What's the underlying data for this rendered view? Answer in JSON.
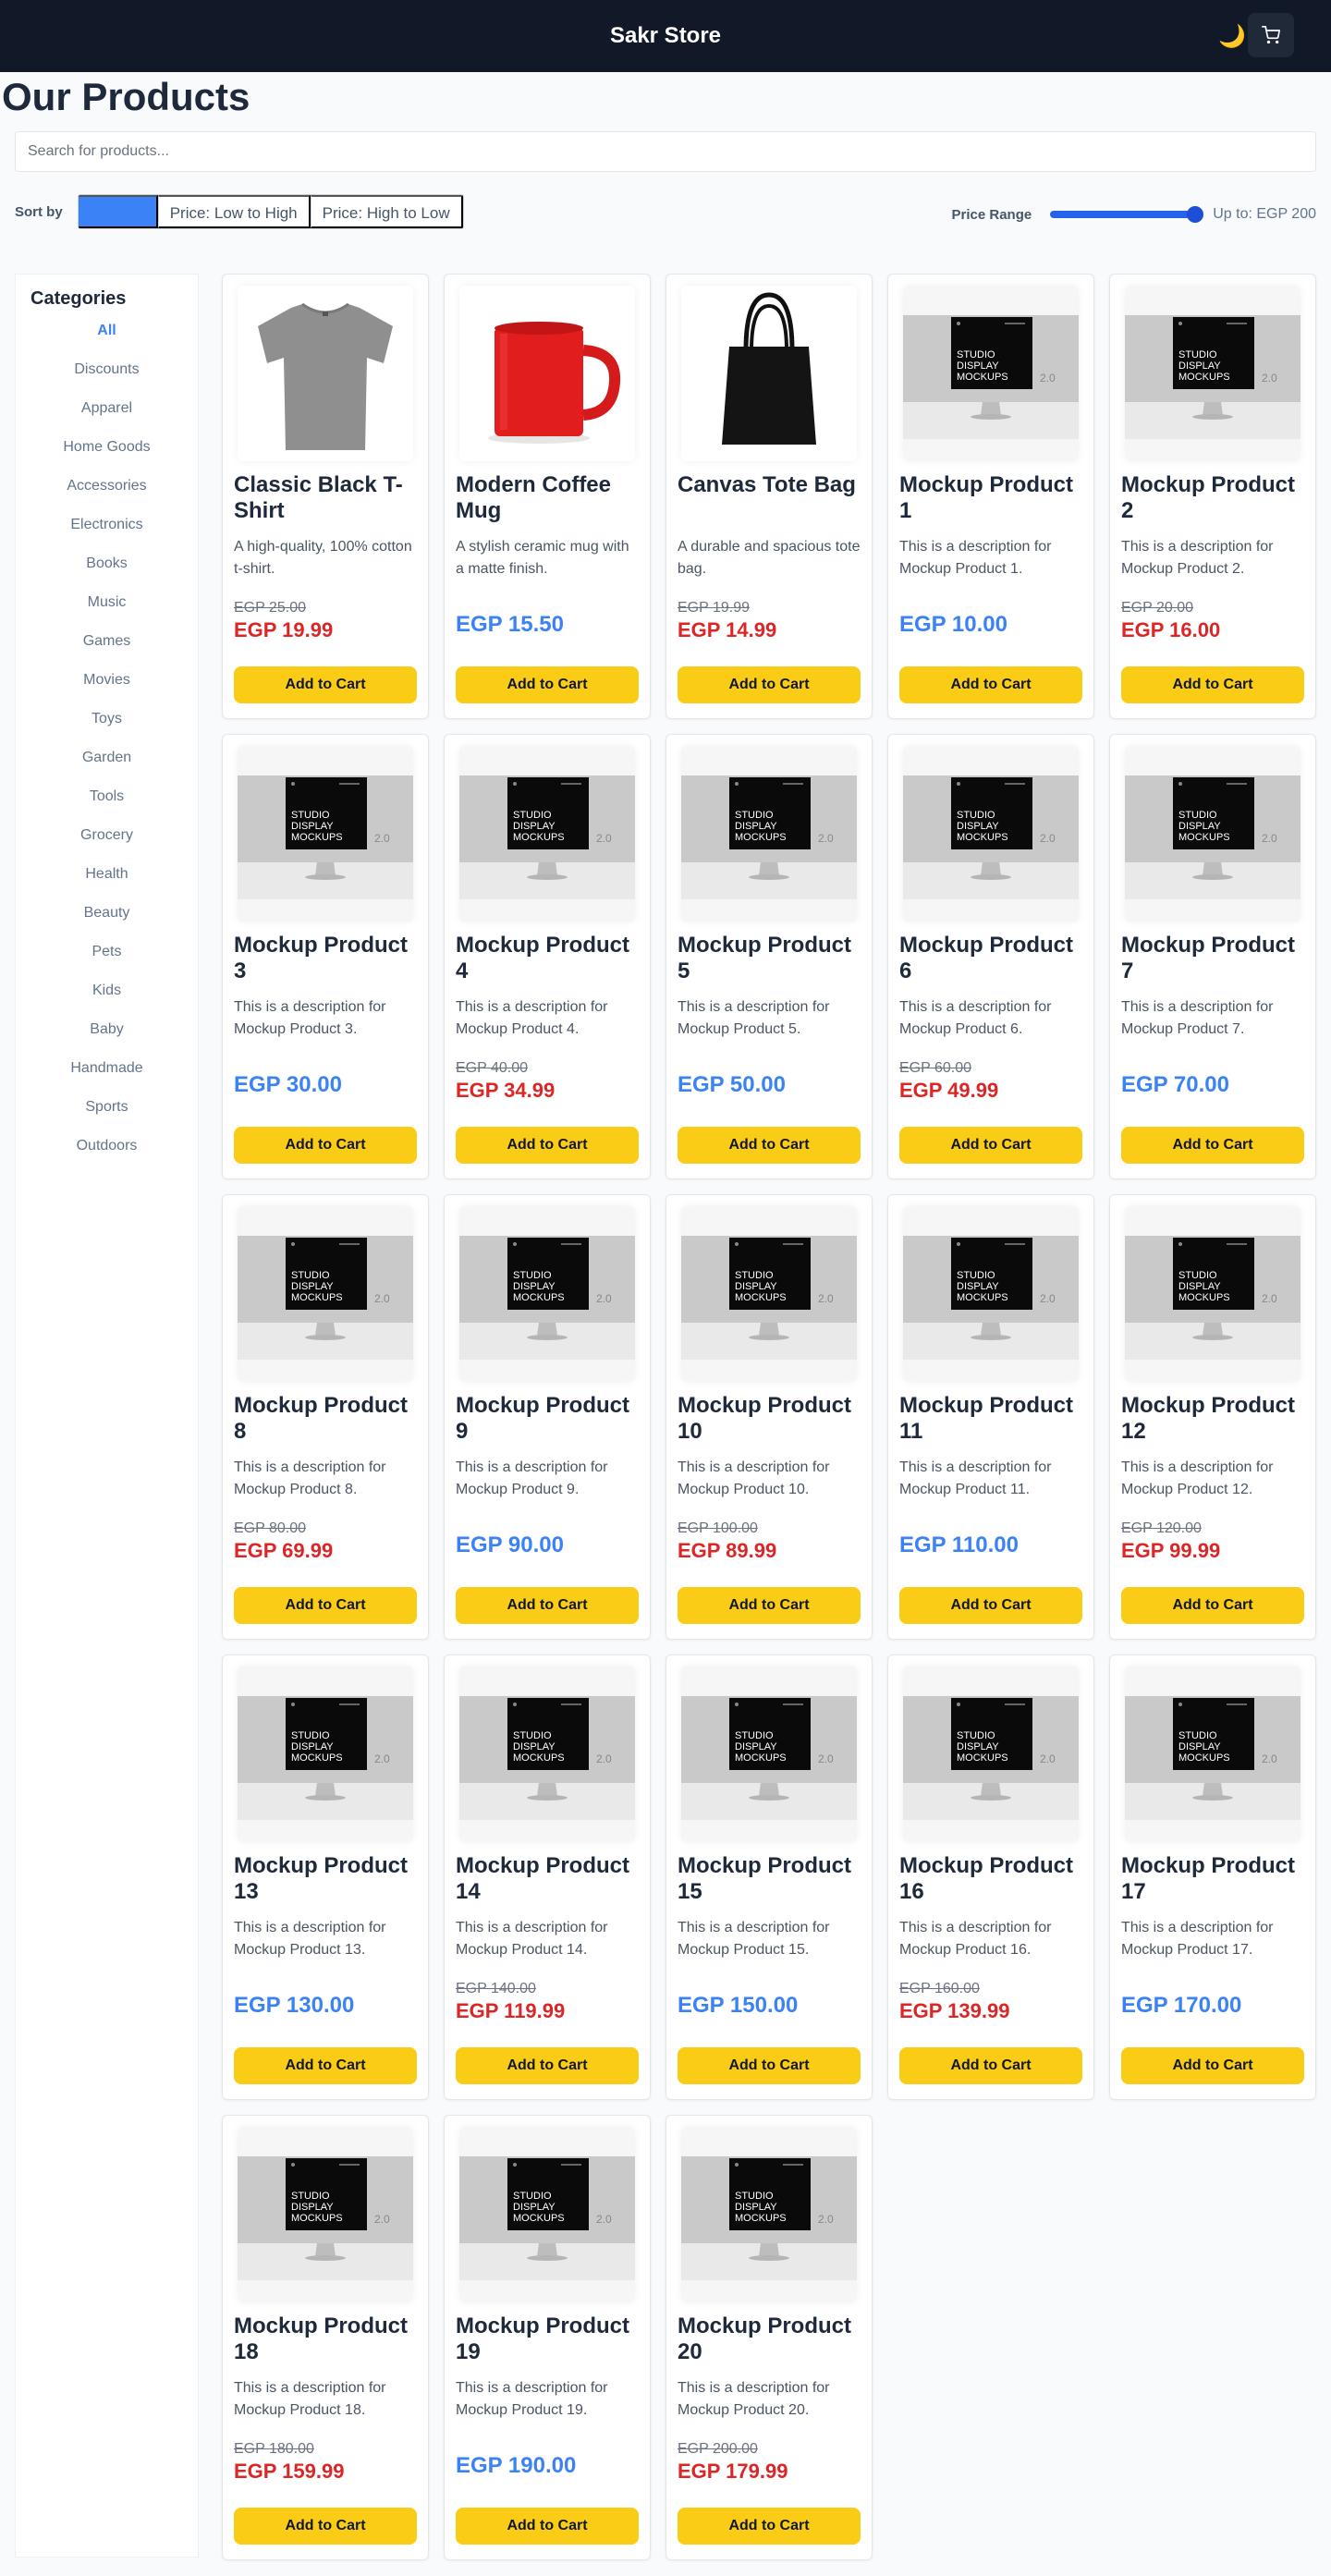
{
  "header": {
    "brand": "Sakr Store",
    "theme_icon": "moon-icon",
    "cart_icon": "cart-icon"
  },
  "page": {
    "title": "Our Products"
  },
  "search": {
    "placeholder": "Search for products..."
  },
  "sort": {
    "label": "Sort by",
    "options": [
      "",
      "Price: Low to High",
      "Price: High to Low"
    ],
    "active_index": 0
  },
  "price_range": {
    "label": "Price Range",
    "value_text": "Up to: EGP 200",
    "max": 200,
    "value": 200
  },
  "categories": {
    "title": "Categories",
    "items": [
      "All",
      "Discounts",
      "Apparel",
      "Home Goods",
      "Accessories",
      "Electronics",
      "Books",
      "Music",
      "Games",
      "Movies",
      "Toys",
      "Garden",
      "Tools",
      "Grocery",
      "Health",
      "Beauty",
      "Pets",
      "Kids",
      "Baby",
      "Handmade",
      "Sports",
      "Outdoors"
    ],
    "active": "All"
  },
  "add_to_cart_label": "Add to Cart",
  "products": [
    {
      "name": "Classic Black T-Shirt",
      "desc": "A high-quality, 100% cotton t-shirt.",
      "old": "EGP 25.00",
      "price": "EGP 19.99",
      "image": "tshirt"
    },
    {
      "name": "Modern Coffee Mug",
      "desc": "A stylish ceramic mug with a matte finish.",
      "old": "",
      "price": "EGP 15.50",
      "image": "mug"
    },
    {
      "name": "Canvas Tote Bag",
      "desc": "A durable and spacious tote bag.",
      "old": "EGP 19.99",
      "price": "EGP 14.99",
      "image": "tote"
    },
    {
      "name": "Mockup Product 1",
      "desc": "This is a description for Mockup Product 1.",
      "old": "",
      "price": "EGP 10.00",
      "image": "monitor"
    },
    {
      "name": "Mockup Product 2",
      "desc": "This is a description for Mockup Product 2.",
      "old": "EGP 20.00",
      "price": "EGP 16.00",
      "image": "monitor"
    },
    {
      "name": "Mockup Product 3",
      "desc": "This is a description for Mockup Product 3.",
      "old": "",
      "price": "EGP 30.00",
      "image": "monitor"
    },
    {
      "name": "Mockup Product 4",
      "desc": "This is a description for Mockup Product 4.",
      "old": "EGP 40.00",
      "price": "EGP 34.99",
      "image": "monitor"
    },
    {
      "name": "Mockup Product 5",
      "desc": "This is a description for Mockup Product 5.",
      "old": "",
      "price": "EGP 50.00",
      "image": "monitor"
    },
    {
      "name": "Mockup Product 6",
      "desc": "This is a description for Mockup Product 6.",
      "old": "EGP 60.00",
      "price": "EGP 49.99",
      "image": "monitor"
    },
    {
      "name": "Mockup Product 7",
      "desc": "This is a description for Mockup Product 7.",
      "old": "",
      "price": "EGP 70.00",
      "image": "monitor"
    },
    {
      "name": "Mockup Product 8",
      "desc": "This is a description for Mockup Product 8.",
      "old": "EGP 80.00",
      "price": "EGP 69.99",
      "image": "monitor"
    },
    {
      "name": "Mockup Product 9",
      "desc": "This is a description for Mockup Product 9.",
      "old": "",
      "price": "EGP 90.00",
      "image": "monitor"
    },
    {
      "name": "Mockup Product 10",
      "desc": "This is a description for Mockup Product 10.",
      "old": "EGP 100.00",
      "price": "EGP 89.99",
      "image": "monitor"
    },
    {
      "name": "Mockup Product 11",
      "desc": "This is a description for Mockup Product 11.",
      "old": "",
      "price": "EGP 110.00",
      "image": "monitor"
    },
    {
      "name": "Mockup Product 12",
      "desc": "This is a description for Mockup Product 12.",
      "old": "EGP 120.00",
      "price": "EGP 99.99",
      "image": "monitor"
    },
    {
      "name": "Mockup Product 13",
      "desc": "This is a description for Mockup Product 13.",
      "old": "",
      "price": "EGP 130.00",
      "image": "monitor"
    },
    {
      "name": "Mockup Product 14",
      "desc": "This is a description for Mockup Product 14.",
      "old": "EGP 140.00",
      "price": "EGP 119.99",
      "image": "monitor"
    },
    {
      "name": "Mockup Product 15",
      "desc": "This is a description for Mockup Product 15.",
      "old": "",
      "price": "EGP 150.00",
      "image": "monitor"
    },
    {
      "name": "Mockup Product 16",
      "desc": "This is a description for Mockup Product 16.",
      "old": "EGP 160.00",
      "price": "EGP 139.99",
      "image": "monitor"
    },
    {
      "name": "Mockup Product 17",
      "desc": "This is a description for Mockup Product 17.",
      "old": "",
      "price": "EGP 170.00",
      "image": "monitor"
    },
    {
      "name": "Mockup Product 18",
      "desc": "This is a description for Mockup Product 18.",
      "old": "EGP 180.00",
      "price": "EGP 159.99",
      "image": "monitor"
    },
    {
      "name": "Mockup Product 19",
      "desc": "This is a description for Mockup Product 19.",
      "old": "",
      "price": "EGP 190.00",
      "image": "monitor"
    },
    {
      "name": "Mockup Product 20",
      "desc": "This is a description for Mockup Product 20.",
      "old": "EGP 200.00",
      "price": "EGP 179.99",
      "image": "monitor"
    }
  ],
  "mockup_image_text": [
    "STUDIO",
    "DISPLAY",
    "MOCKUPS",
    "2.0"
  ],
  "colors": {
    "header_bg": "#111827",
    "accent": "#3b82f6",
    "sale_price": "#dc2626",
    "button": "#facc15"
  }
}
